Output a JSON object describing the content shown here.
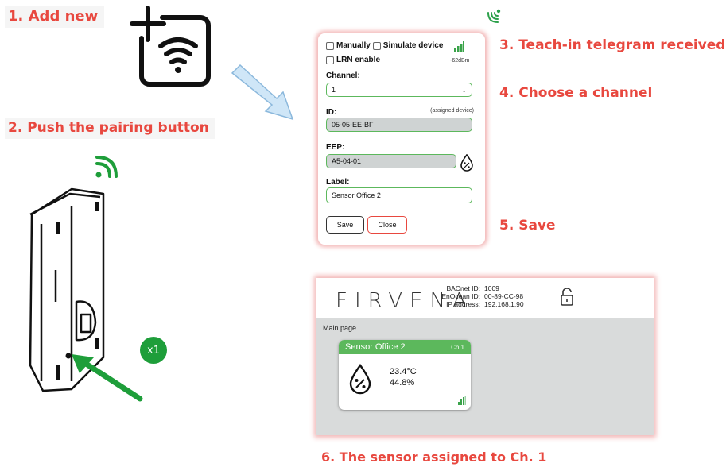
{
  "steps": {
    "s1": "1. Add new",
    "s2": "2. Push the pairing button",
    "s3": "3. Teach-in telegram received",
    "s4": "4. Choose a channel",
    "s5": "5. Save",
    "s6": "6. The sensor assigned to Ch. 1"
  },
  "icons": {
    "add_new": "add-wireless-device-icon",
    "signal": "wireless-signal-icon",
    "arrow": "arrow-down-right-icon",
    "pointer": "green-arrow-icon",
    "press_count": "x1"
  },
  "dialog": {
    "manually": "Manually",
    "simulate": "Simulate device",
    "lrn": "LRN enable",
    "rssi": "-62dBm",
    "channel_label": "Channel:",
    "channel_value": "1",
    "id_label": "ID:",
    "id_note": "(assigned device)",
    "id_value": "05-05-EE-BF",
    "eep_label": "EEP:",
    "eep_value": "A5-04-01",
    "label_label": "Label:",
    "label_value": "Sensor Office 2",
    "save": "Save",
    "close": "Close"
  },
  "dashboard": {
    "logo": "FIRVENA",
    "bacnet_label": "BACnet ID:",
    "bacnet_value": "1009",
    "enocean_label": "EnOcean ID:",
    "enocean_value": "00-89-CC-98",
    "ip_label": "IP address:",
    "ip_value": "192.168.1.90",
    "page": "Main page",
    "card": {
      "title": "Sensor Office 2",
      "channel": "Ch 1",
      "temperature": "23.4°C",
      "humidity": "44.8%"
    }
  },
  "colors": {
    "accent_red": "#e8483f",
    "green": "#5cb85c",
    "dark_green": "#1e9e3a"
  }
}
